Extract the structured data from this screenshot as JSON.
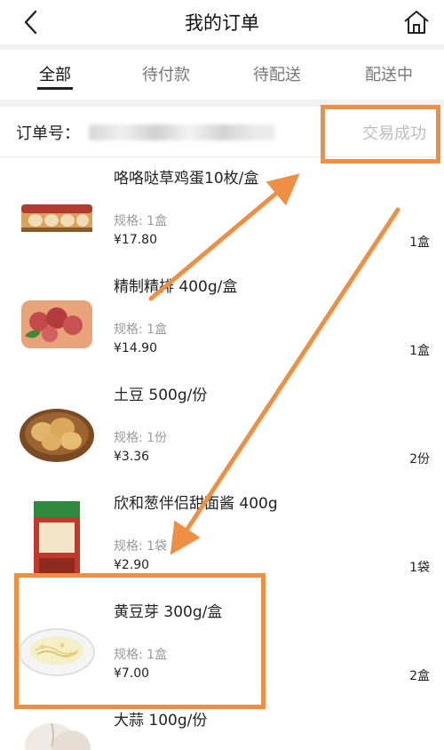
{
  "header": {
    "title": "我的订单",
    "back_icon": "chevron-left-icon",
    "home_icon": "home-icon"
  },
  "tabs": [
    {
      "label": "全部",
      "active": true
    },
    {
      "label": "待付款",
      "active": false
    },
    {
      "label": "待配送",
      "active": false
    },
    {
      "label": "配送中",
      "active": false
    }
  ],
  "order": {
    "number_label": "订单号：",
    "status": "交易成功",
    "items": [
      {
        "name": "咯咯哒草鸡蛋10枚/盒",
        "spec": "规格: 1盒",
        "price": "¥17.80",
        "qty": "1盒"
      },
      {
        "name": "精制精排 400g/盒",
        "spec": "规格: 1盒",
        "price": "¥14.90",
        "qty": "1盒"
      },
      {
        "name": "土豆 500g/份",
        "spec": "规格: 1份",
        "price": "¥3.36",
        "qty": "2份"
      },
      {
        "name": "欣和葱伴侣甜面酱 400g",
        "spec": "规格: 1袋",
        "price": "¥2.90",
        "qty": "1袋"
      },
      {
        "name": "黄豆芽 300g/盒",
        "spec": "规格: 1盒",
        "price": "¥7.00",
        "qty": "2盒"
      },
      {
        "name": "大蒜 100g/份",
        "spec": "",
        "price": "",
        "qty": ""
      }
    ]
  },
  "annotation": {
    "color": "#ef8f44"
  },
  "colors": {
    "background": "#f2f2f2",
    "status_text": "#bdbdbd",
    "spec_text": "#9a9a9a"
  }
}
